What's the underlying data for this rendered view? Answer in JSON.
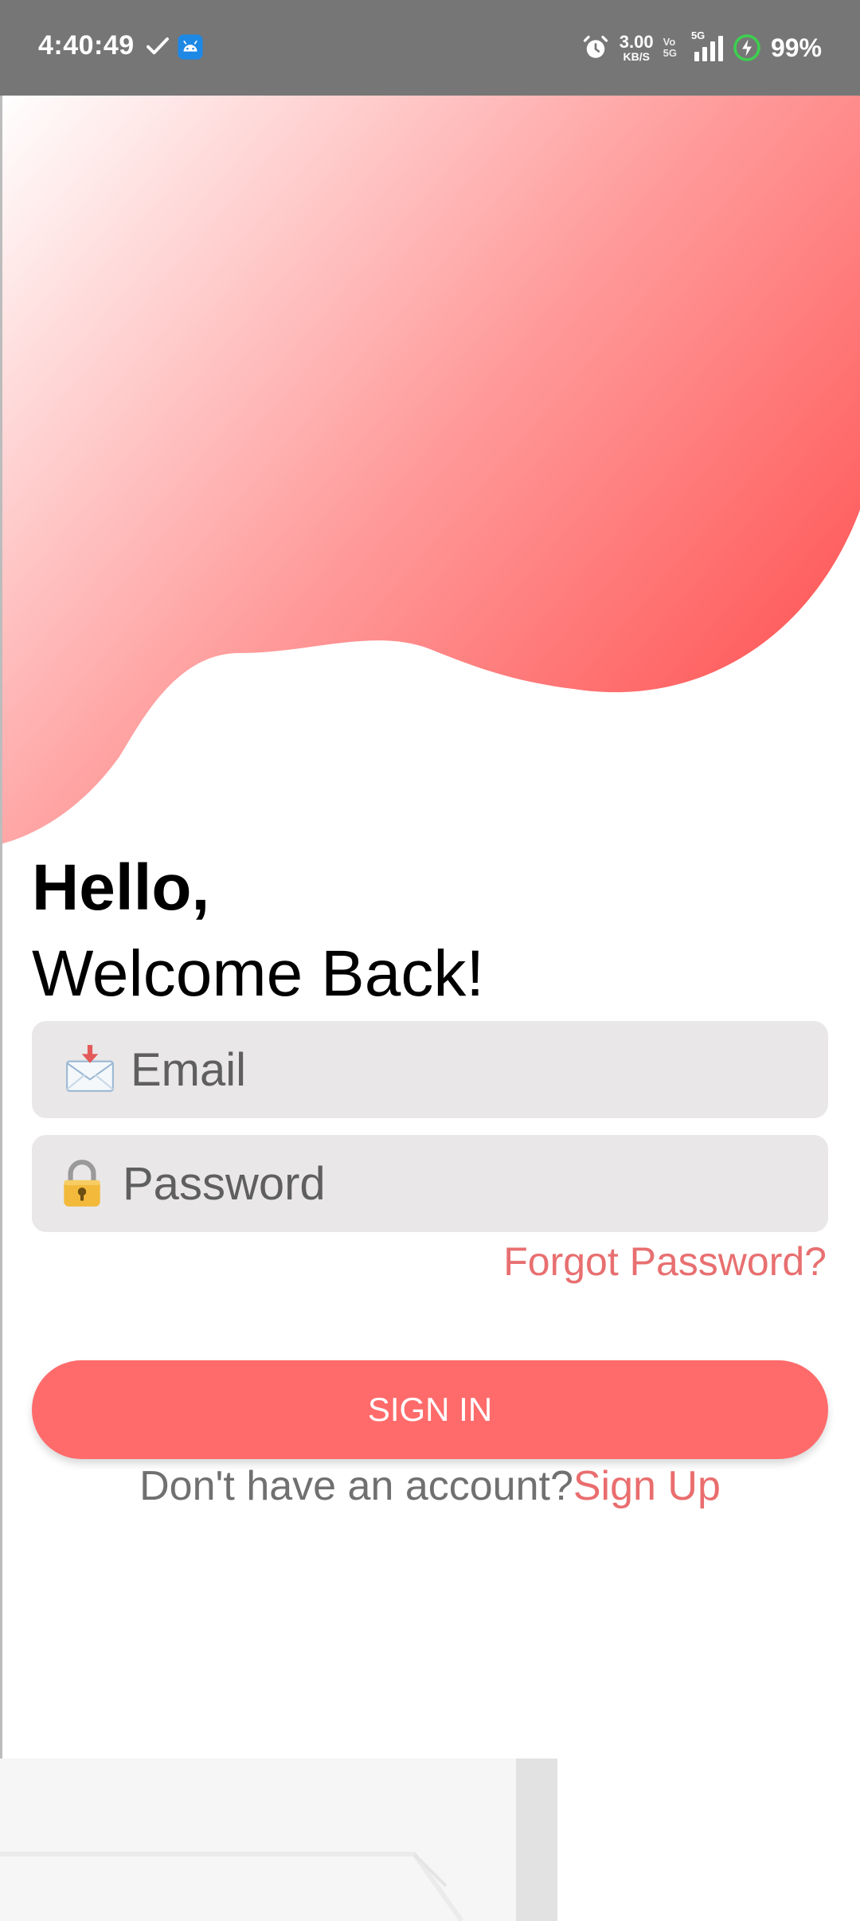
{
  "status_bar": {
    "time": "4:40:49",
    "net_speed_value": "3.00",
    "net_speed_unit": "KB/S",
    "volte_top": "Vo",
    "volte_bottom": "5G",
    "network_tag": "5G",
    "battery": "99%",
    "icons": [
      "check-icon",
      "android-app-icon",
      "alarm-icon",
      "signal-icon",
      "battery-charging-icon"
    ]
  },
  "greeting": {
    "hello": "Hello,",
    "welcome": "Welcome Back!"
  },
  "form": {
    "email_placeholder": "Email",
    "email_value": "",
    "password_placeholder": "Password",
    "password_value": "",
    "forgot_password": "Forgot Password?",
    "sign_in": "SIGN IN",
    "no_account": "Don't have an account?",
    "sign_up": "Sign Up"
  },
  "colors": {
    "accent": "#ff6b6b",
    "link": "#ea6d6e",
    "field_bg": "#e9e7e8",
    "status_bar": "#767676"
  }
}
